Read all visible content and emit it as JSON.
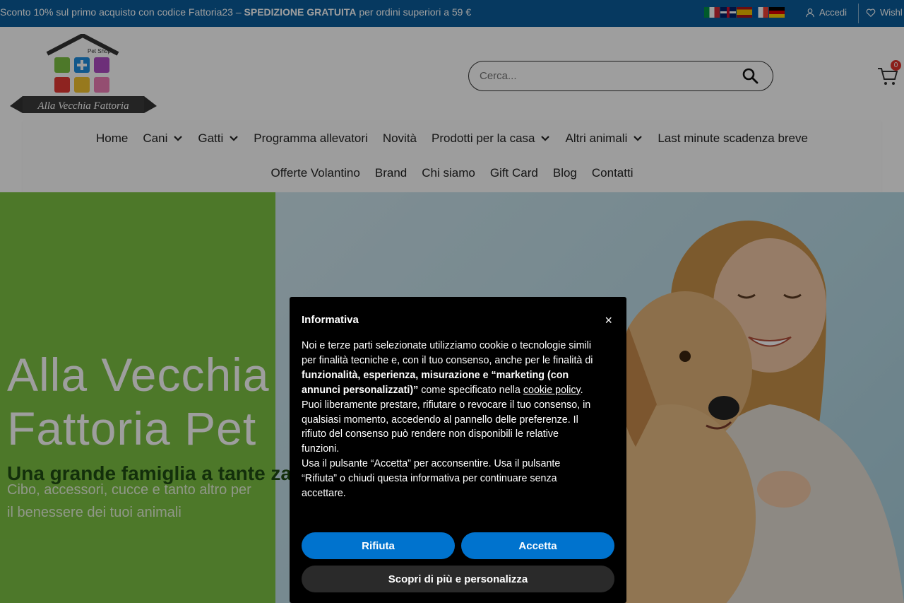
{
  "topbar": {
    "promo_prefix": "Sconto 10% sul primo acquisto con codice Fattoria23 – ",
    "promo_bold": "SPEDIZIONE GRATUITA",
    "promo_suffix": " per ordini superiori a 59 €",
    "languages": [
      "it",
      "en",
      "es",
      "fr",
      "de"
    ],
    "login_label": "Accedi",
    "wishlist_label": "Wishl"
  },
  "header": {
    "logo_top_text": "Pet Shop",
    "logo_banner_text": "Alla Vecchia Fattoria",
    "search_placeholder": "Cerca...",
    "cart_count": "0"
  },
  "nav": {
    "row1": [
      {
        "label": "Home",
        "dropdown": false
      },
      {
        "label": "Cani",
        "dropdown": true
      },
      {
        "label": "Gatti",
        "dropdown": true
      },
      {
        "label": "Programma allevatori",
        "dropdown": false
      },
      {
        "label": "Novità",
        "dropdown": false
      },
      {
        "label": "Prodotti per la casa",
        "dropdown": true
      },
      {
        "label": "Altri animali",
        "dropdown": true
      },
      {
        "label": "Last minute scadenza breve",
        "dropdown": false
      }
    ],
    "row2": [
      {
        "label": "Offerte Volantino",
        "dropdown": false
      },
      {
        "label": "Brand",
        "dropdown": false
      },
      {
        "label": "Chi siamo",
        "dropdown": false
      },
      {
        "label": "Gift Card",
        "dropdown": false
      },
      {
        "label": "Blog",
        "dropdown": false
      },
      {
        "label": "Contatti",
        "dropdown": false
      }
    ]
  },
  "hero": {
    "title_line1": "Alla Vecchia",
    "title_line2": "Fattoria Pet",
    "subtitle": "Una grande famiglia a tante zampe",
    "text": "Cibo, accessori, cucce e tanto altro per il benessere dei tuoi animali"
  },
  "cookie": {
    "title": "Informativa",
    "close": "×",
    "p1_a": "Noi e terze parti selezionate utilizziamo cookie o tecnologie simili per finalità tecniche e, con il tuo consenso, anche per le finalità di ",
    "p1_bold": "funzionalità, esperienza, misurazione e “marketing (con annunci personalizzati)”",
    "p1_b": " come specificato nella ",
    "p1_link": "cookie policy",
    "p1_c": ".",
    "p2": "Puoi liberamente prestare, rifiutare o revocare il tuo consenso, in qualsiasi momento, accedendo al pannello delle preferenze. Il rifiuto del consenso può rendere non disponibili le relative funzioni.",
    "p3": "Usa il pulsante “Accetta” per acconsentire. Usa il pulsante “Rifiuta” o chiudi questa informativa per continuare senza accettare.",
    "reject_label": "Rifiuta",
    "accept_label": "Accetta",
    "more_label": "Scopri di più e personalizza"
  },
  "colors": {
    "topbar": "#0a5d9c",
    "hero_green": "#7cc243",
    "button_blue": "#0073ce"
  }
}
